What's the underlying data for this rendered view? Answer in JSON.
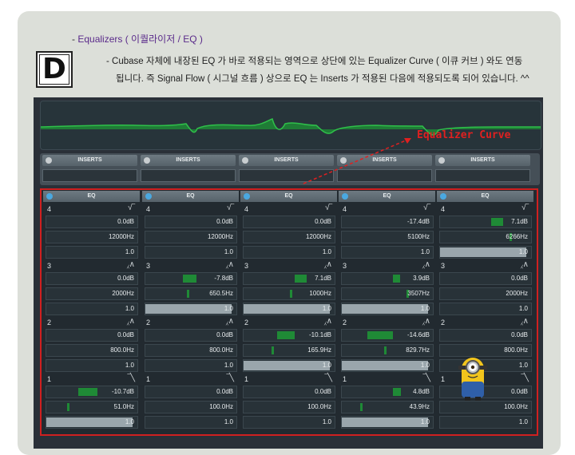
{
  "heading": {
    "dash": "-",
    "title": "Equalizers ( 이퀄라이저 / EQ )"
  },
  "badge": "D",
  "description": {
    "line1": "- Cubase 자체에 내장된 EQ 가 바로 적용되는 영역으로 상단에 있는 Equalizer Curve ( 이큐 커브 ) 와도 연동",
    "line2": "됩니다. 즉 Signal Flow ( 시그널 흐름 ) 상으로 EQ 는 Inserts 가 적용된 다음에 적용되도록 되어 있습니다. ^^"
  },
  "curve_label": "Equalizer Curve",
  "colors": {
    "accent_red": "#e02020",
    "eq_green": "#1f8a36",
    "panel": "#222a30"
  },
  "inserts": {
    "label": "INSERTS",
    "count": 5
  },
  "eq_label": "EQ",
  "channels": [
    {
      "bands": [
        {
          "num": "4",
          "icon": "shelf-high-icon",
          "gain": "0.0dB",
          "freq": "12000Hz",
          "q": "1.0",
          "gain_fill": 0,
          "freq_fill": 0,
          "q_fill": 0
        },
        {
          "num": "3",
          "icon": "peak-icon",
          "gain": "0.0dB",
          "freq": "2000Hz",
          "q": "1.0",
          "gain_fill": 0,
          "freq_fill": 0,
          "q_fill": 0
        },
        {
          "num": "2",
          "icon": "peak-icon",
          "gain": "0.0dB",
          "freq": "800.0Hz",
          "q": "1.0",
          "gain_fill": 0,
          "freq_fill": 0,
          "q_fill": 0
        },
        {
          "num": "1",
          "icon": "shelf-low-icon",
          "gain": "-10.7dB",
          "freq": "51.0Hz",
          "q": "1.0",
          "gain_fill": -0.45,
          "freq_fill": 0.22,
          "q_fill": 0.95
        }
      ]
    },
    {
      "bands": [
        {
          "num": "4",
          "icon": "shelf-high-icon",
          "gain": "0.0dB",
          "freq": "12000Hz",
          "q": "1.0",
          "gain_fill": 0,
          "freq_fill": 0,
          "q_fill": 0
        },
        {
          "num": "3",
          "icon": "peak-icon",
          "gain": "-7.8dB",
          "freq": "650.5Hz",
          "q": "1.0",
          "gain_fill": -0.33,
          "freq_fill": 0.45,
          "q_fill": 0.95
        },
        {
          "num": "2",
          "icon": "peak-icon",
          "gain": "0.0dB",
          "freq": "800.0Hz",
          "q": "1.0",
          "gain_fill": 0,
          "freq_fill": 0,
          "q_fill": 0
        },
        {
          "num": "1",
          "icon": "shelf-low-icon",
          "gain": "0.0dB",
          "freq": "100.0Hz",
          "q": "1.0",
          "gain_fill": 0,
          "freq_fill": 0,
          "q_fill": 0
        }
      ]
    },
    {
      "bands": [
        {
          "num": "4",
          "icon": "shelf-high-icon",
          "gain": "0.0dB",
          "freq": "12000Hz",
          "q": "1.0",
          "gain_fill": 0,
          "freq_fill": 0,
          "q_fill": 0
        },
        {
          "num": "3",
          "icon": "peak-icon",
          "gain": "7.1dB",
          "freq": "1000Hz",
          "q": "1.0",
          "gain_fill": 0.3,
          "freq_fill": 0.5,
          "q_fill": 0.95
        },
        {
          "num": "2",
          "icon": "peak-icon",
          "gain": "-10.1dB",
          "freq": "165.9Hz",
          "q": "1.0",
          "gain_fill": -0.42,
          "freq_fill": 0.3,
          "q_fill": 0.95
        },
        {
          "num": "1",
          "icon": "shelf-low-icon",
          "gain": "0.0dB",
          "freq": "100.0Hz",
          "q": "1.0",
          "gain_fill": 0,
          "freq_fill": 0,
          "q_fill": 0
        }
      ]
    },
    {
      "bands": [
        {
          "num": "4",
          "icon": "shelf-high-icon",
          "gain": "-17.4dB",
          "freq": "5100Hz",
          "q": "1.0",
          "gain_fill": 0,
          "freq_fill": 0,
          "q_fill": 0
        },
        {
          "num": "3",
          "icon": "peak-icon",
          "gain": "3.9dB",
          "freq": "3507Hz",
          "q": "1.0",
          "gain_fill": 0.17,
          "freq_fill": 0.7,
          "q_fill": 0.95
        },
        {
          "num": "2",
          "icon": "peak-icon",
          "gain": "-14.6dB",
          "freq": "829.7Hz",
          "q": "1.0",
          "gain_fill": -0.6,
          "freq_fill": 0.46,
          "q_fill": 0.95
        },
        {
          "num": "1",
          "icon": "shelf-low-icon",
          "gain": "4.8dB",
          "freq": "43.9Hz",
          "q": "1.0",
          "gain_fill": 0.2,
          "freq_fill": 0.2,
          "q_fill": 0.95
        }
      ]
    },
    {
      "bands": [
        {
          "num": "4",
          "icon": "shelf-high-icon",
          "gain": "7.1dB",
          "freq": "6266Hz",
          "q": "1.0",
          "gain_fill": 0.3,
          "freq_fill": 0.75,
          "q_fill": 0.95
        },
        {
          "num": "3",
          "icon": "peak-icon",
          "gain": "0.0dB",
          "freq": "2000Hz",
          "q": "1.0",
          "gain_fill": 0,
          "freq_fill": 0,
          "q_fill": 0
        },
        {
          "num": "2",
          "icon": "peak-icon",
          "gain": "0.0dB",
          "freq": "800.0Hz",
          "q": "1.0",
          "gain_fill": 0,
          "freq_fill": 0,
          "q_fill": 0
        },
        {
          "num": "1",
          "icon": "shelf-low-icon",
          "gain": "0.0dB",
          "freq": "100.0Hz",
          "q": "1.0",
          "gain_fill": 0,
          "freq_fill": 0,
          "q_fill": 0
        }
      ]
    }
  ]
}
